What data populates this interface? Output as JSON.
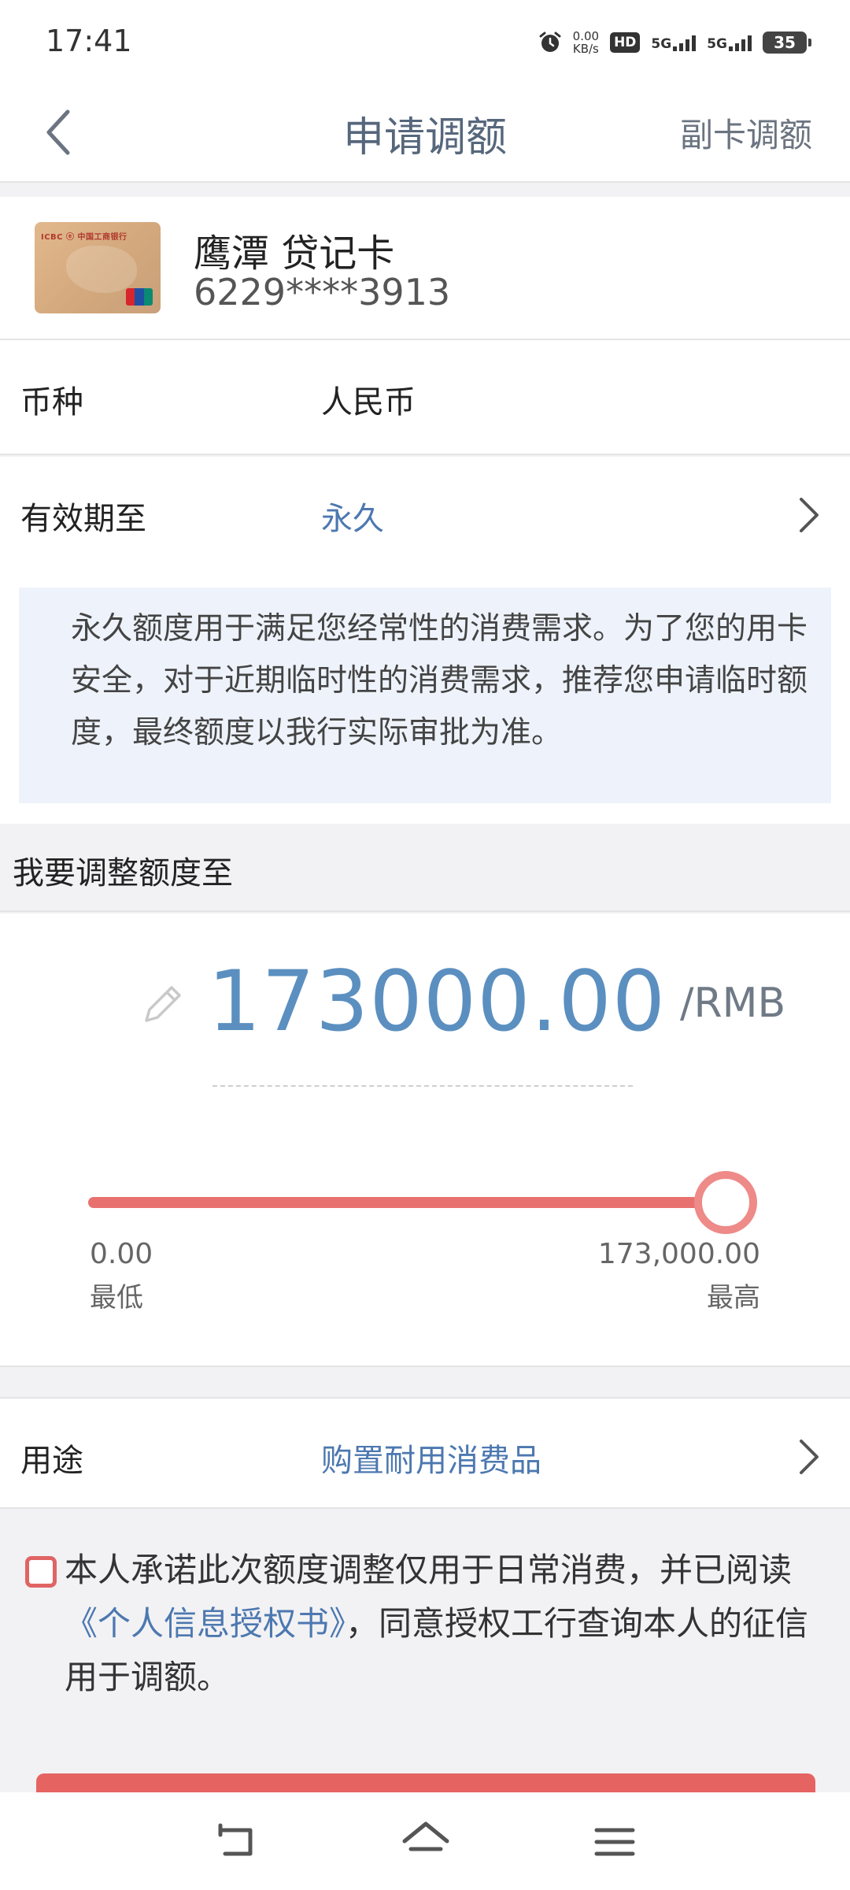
{
  "status_bar": {
    "time": "17:41",
    "net_speed_value": "0.00",
    "net_speed_unit": "KB/s",
    "hd_label": "HD",
    "sim1_label": "5G",
    "sim2_label": "5G",
    "battery": "35"
  },
  "nav": {
    "title": "申请调额",
    "right_action": "副卡调额"
  },
  "card": {
    "name": "鹰潭 贷记卡",
    "number": "6229****3913",
    "thumb_bank_text": "ICBC ⓔ 中国工商银行"
  },
  "currency_row": {
    "label": "币种",
    "value": "人民币"
  },
  "validity_row": {
    "label": "有效期至",
    "value": "永久"
  },
  "notice": {
    "text": "永久额度用于满足您经常性的消费需求。为了您的用卡安全，对于近期临时性的消费需求，推荐您申请临时额度，最终额度以我行实际审批为准。"
  },
  "adjust_section": {
    "title": "我要调整额度至"
  },
  "amount": {
    "value": "173000.00",
    "unit": "/RMB",
    "slider_fraction": 1.0
  },
  "slider": {
    "min_value": "0.00",
    "min_label": "最低",
    "max_value": "173,000.00",
    "max_label": "最高"
  },
  "usage_row": {
    "label": "用途",
    "value": "购置耐用消费品"
  },
  "consent": {
    "checked": false,
    "text_before": "本人承诺此次额度调整仅用于日常消费，并已阅读",
    "link": "《个人信息授权书》",
    "text_after": "，同意授权工行查询本人的征信用于调额。"
  },
  "colors": {
    "accent_blue": "#5b8fc0",
    "link_blue": "#4d78b0",
    "accent_red": "#e8716f",
    "title_slate": "#56677c"
  },
  "icons": {
    "back": "back-chevron-icon",
    "chevron": "chevron-right-icon",
    "pencil": "pencil-icon",
    "alarm": "alarm-icon",
    "nav_back": "system-back-icon",
    "nav_home": "home-icon",
    "nav_menu": "menu-icon"
  }
}
